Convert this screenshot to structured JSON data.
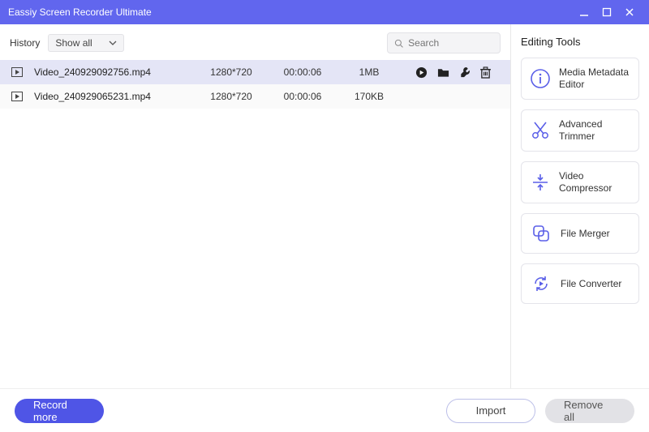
{
  "app": {
    "title": "Eassiy Screen Recorder Ultimate"
  },
  "toolbar": {
    "history_label": "History",
    "filter_label": "Show all",
    "search_placeholder": "Search"
  },
  "files": [
    {
      "name": "Video_240929092756.mp4",
      "resolution": "1280*720",
      "duration": "00:00:06",
      "size": "1MB",
      "selected": true
    },
    {
      "name": "Video_240929065231.mp4",
      "resolution": "1280*720",
      "duration": "00:00:06",
      "size": "170KB",
      "selected": false
    }
  ],
  "editing_tools_title": "Editing Tools",
  "tools": {
    "metadata": "Media Metadata Editor",
    "trimmer": "Advanced Trimmer",
    "compressor": "Video Compressor",
    "merger": "File Merger",
    "converter": "File Converter"
  },
  "footer": {
    "record_more": "Record more",
    "import": "Import",
    "remove_all": "Remove all"
  }
}
